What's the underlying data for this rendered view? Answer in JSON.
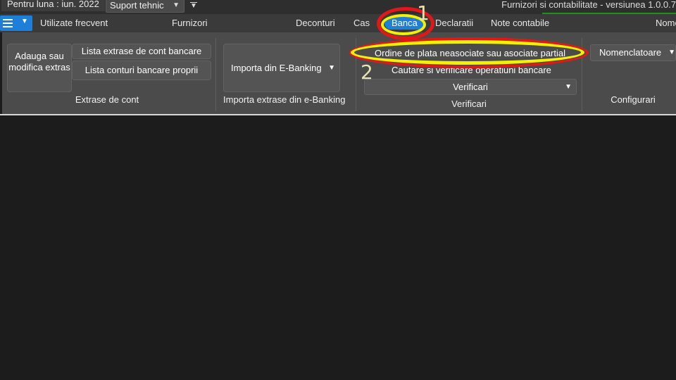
{
  "topbar": {
    "month_label": "Pentru luna : iun. 2022",
    "support_label": "Suport tehnic",
    "app_title": "Furnizori si contabilitate - versiunea 1.0.0.7"
  },
  "menu": {
    "tabs": [
      {
        "label": "Utilizate frecvent"
      },
      {
        "label": "Furnizori"
      },
      {
        "label": "Deconturi"
      },
      {
        "label": "Cas"
      },
      {
        "label": "Banca"
      },
      {
        "label": "Declaratii"
      },
      {
        "label": "Note contabile"
      },
      {
        "label": "Nome"
      }
    ],
    "active_tab": "Banca"
  },
  "ribbon": {
    "extrase": {
      "add_button": "Adauga  sau modifica extras",
      "list_extrase": "Lista extrase de cont bancare",
      "list_conturi": "Lista conturi bancare proprii",
      "label": "Extrase de cont"
    },
    "import": {
      "ebanking_button": "Importa din E-Banking",
      "label": "Importa extrase din e-Banking"
    },
    "verificari": {
      "ordine": "Ordine de plata neasociate sau asociate partial",
      "cautare": "Cautare si verificare operatiuni bancare",
      "combo": "Verificari",
      "label": "Verificari"
    },
    "configurari": {
      "combo": "Nomenclatoare",
      "label": "Configurari"
    }
  },
  "annotations": {
    "step1": "1",
    "step2": "2",
    "ring_red": "#e01818",
    "ring_yellow": "#f5ef00"
  },
  "colors": {
    "accent": "#1e7fd8",
    "ribbon_bg": "#4b4b4b",
    "workspace_bg": "#1c1c1c"
  }
}
